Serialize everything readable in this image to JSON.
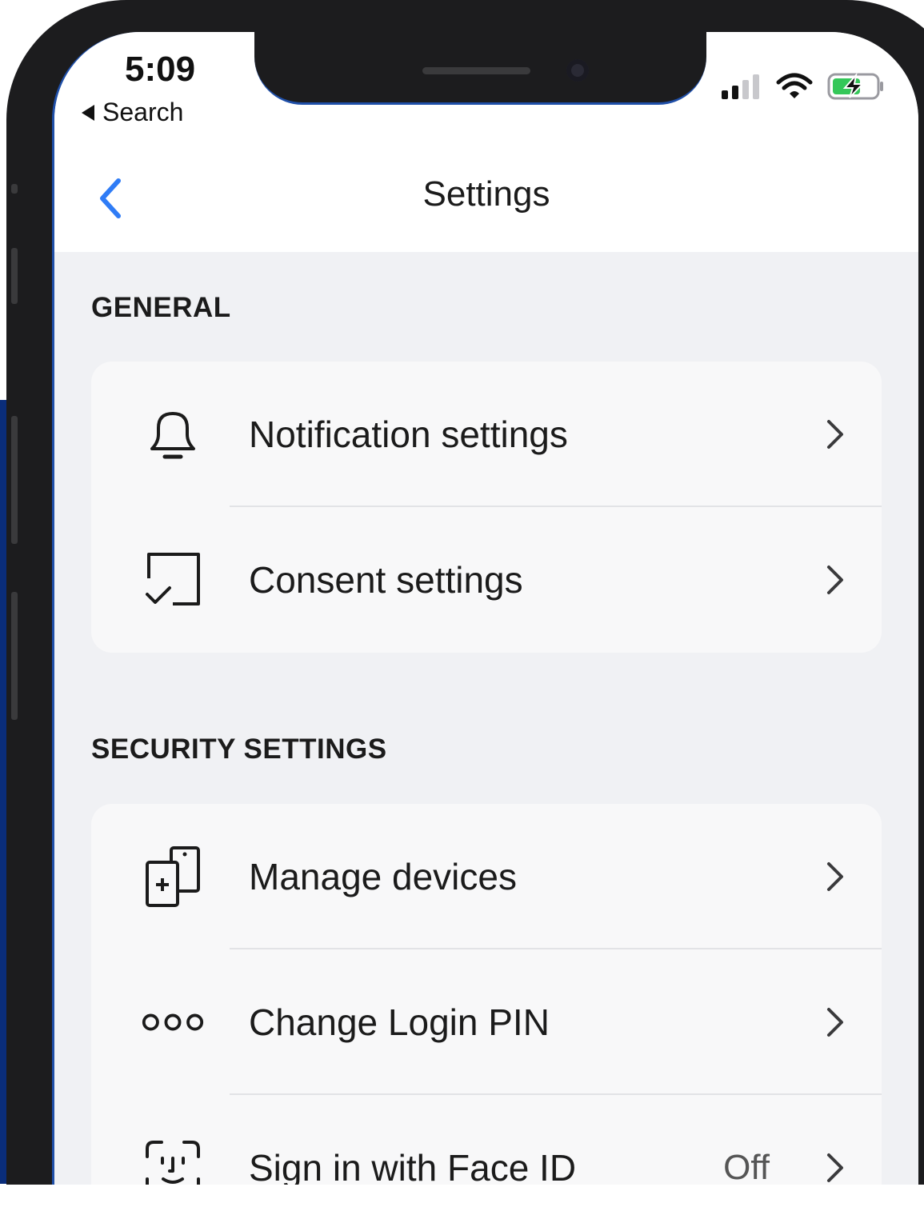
{
  "status_bar": {
    "time": "5:09",
    "back_app": "Search",
    "icons": [
      "cellular-signal-icon",
      "wifi-icon",
      "battery-charging-icon"
    ],
    "battery_color": "#34c759"
  },
  "nav": {
    "title": "Settings",
    "back_icon": "chevron-left-icon",
    "accent": "#2f7cf6"
  },
  "sections": {
    "general": {
      "title": "GENERAL",
      "items": [
        {
          "label": "Notification settings",
          "icon": "bell-icon"
        },
        {
          "label": "Consent settings",
          "icon": "checkbox-icon"
        }
      ]
    },
    "security": {
      "title": "SECURITY SETTINGS",
      "items": [
        {
          "label": "Manage devices",
          "icon": "devices-icon"
        },
        {
          "label": "Change Login PIN",
          "icon": "pin-dots-icon"
        },
        {
          "label": "Sign in with Face ID",
          "icon": "face-id-icon",
          "value": "Off"
        }
      ]
    }
  }
}
